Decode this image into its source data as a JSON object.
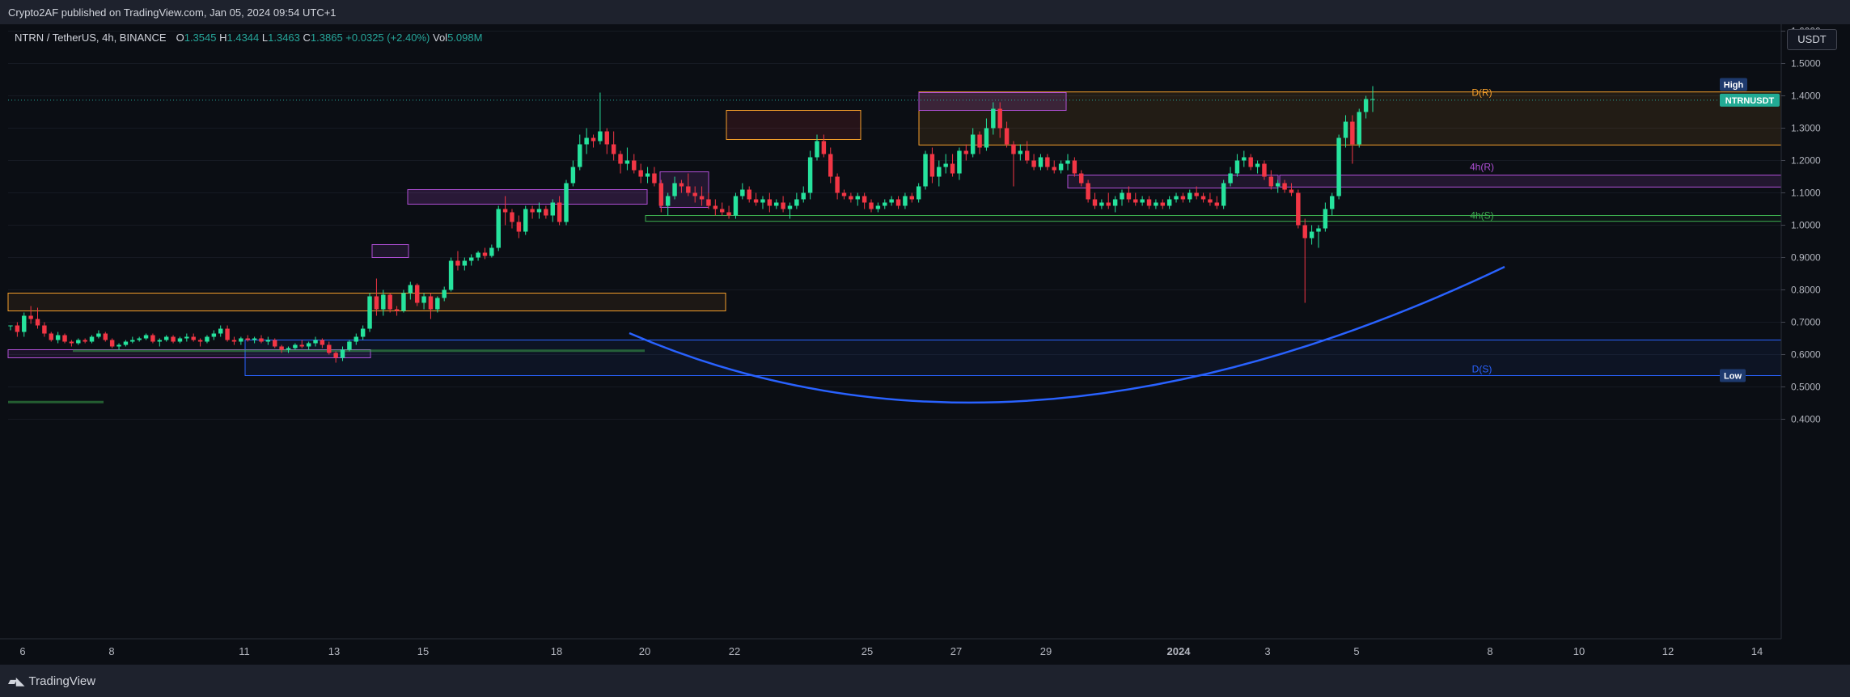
{
  "header": {
    "published": "Crypto2AF published on TradingView.com, Jan 05, 2024 09:54 UTC+1"
  },
  "legend": {
    "symbol": "NTRN / TetherUS, 4h, BINANCE",
    "o_label": "O",
    "o_value": "1.3545",
    "h_label": "H",
    "h_value": "1.4344",
    "l_label": "L",
    "l_value": "1.3463",
    "c_label": "C",
    "c_value": "1.3865",
    "change": "+0.0325 (+2.40%)",
    "vol_label": "Vol",
    "vol_value": "5.098M"
  },
  "price_scale": {
    "unit": "USDT",
    "high_tag": "High",
    "low_tag": "Low",
    "symbol_tag": "NTRNUSDT"
  },
  "footer": {
    "brand": "TradingView"
  },
  "colors": {
    "up": "#26e39d",
    "down": "#f23645",
    "curve": "#2962ff",
    "daily_res": "#f59f2b",
    "res4h": "#b04fd6",
    "sup4h": "#3dae4f",
    "daily_sup": "#2962ff"
  },
  "chart_data": {
    "type": "candlestick",
    "symbol": "NTRN / TetherUS",
    "interval": "4h",
    "exchange": "BINANCE",
    "ylim": [
      0.38,
      1.9
    ],
    "y_ticks": [
      "1.6000",
      "1.5000",
      "1.4000",
      "1.3000",
      "1.2000",
      "1.1000",
      "1.0000",
      "0.9000",
      "0.8000",
      "0.7000",
      "0.6000",
      "0.5000",
      "0.4000"
    ],
    "x_ticks": [
      "6",
      "8",
      "11",
      "13",
      "15",
      "18",
      "20",
      "22",
      "25",
      "27",
      "29",
      "2024",
      "3",
      "5",
      "8",
      "10",
      "12",
      "14"
    ],
    "last_price": 1.3865,
    "zones": [
      {
        "label": "D(R)",
        "from": 1.248,
        "to": 1.412
      },
      {
        "label": "4h(R)",
        "from": 1.118,
        "to": 1.155
      },
      {
        "label": "4h(S)",
        "from": 1.012,
        "to": 1.03
      },
      {
        "label": "D(S)",
        "from": 0.535,
        "to": 0.645
      }
    ],
    "annotations": [
      "D(R)",
      "4h(R)",
      "4h(S)",
      "D(S)"
    ],
    "candles": [
      [
        0.69,
        0.69,
        0.675,
        0.69
      ],
      [
        0.69,
        0.7,
        0.655,
        0.67
      ],
      [
        0.67,
        0.73,
        0.655,
        0.72
      ],
      [
        0.72,
        0.75,
        0.695,
        0.71
      ],
      [
        0.71,
        0.745,
        0.68,
        0.69
      ],
      [
        0.69,
        0.7,
        0.655,
        0.665
      ],
      [
        0.665,
        0.67,
        0.64,
        0.645
      ],
      [
        0.645,
        0.67,
        0.635,
        0.66
      ],
      [
        0.66,
        0.665,
        0.635,
        0.64
      ],
      [
        0.64,
        0.645,
        0.625,
        0.635
      ],
      [
        0.635,
        0.65,
        0.63,
        0.645
      ],
      [
        0.645,
        0.65,
        0.635,
        0.64
      ],
      [
        0.64,
        0.66,
        0.635,
        0.655
      ],
      [
        0.655,
        0.675,
        0.65,
        0.665
      ],
      [
        0.665,
        0.67,
        0.64,
        0.645
      ],
      [
        0.645,
        0.65,
        0.62,
        0.625
      ],
      [
        0.625,
        0.635,
        0.615,
        0.63
      ],
      [
        0.63,
        0.645,
        0.625,
        0.64
      ],
      [
        0.64,
        0.655,
        0.635,
        0.645
      ],
      [
        0.645,
        0.655,
        0.64,
        0.65
      ],
      [
        0.65,
        0.665,
        0.645,
        0.66
      ],
      [
        0.66,
        0.665,
        0.635,
        0.64
      ],
      [
        0.64,
        0.65,
        0.625,
        0.645
      ],
      [
        0.645,
        0.66,
        0.64,
        0.655
      ],
      [
        0.655,
        0.66,
        0.635,
        0.64
      ],
      [
        0.64,
        0.655,
        0.635,
        0.65
      ],
      [
        0.65,
        0.665,
        0.64,
        0.655
      ],
      [
        0.655,
        0.665,
        0.64,
        0.645
      ],
      [
        0.645,
        0.65,
        0.625,
        0.64
      ],
      [
        0.64,
        0.66,
        0.635,
        0.655
      ],
      [
        0.655,
        0.675,
        0.645,
        0.665
      ],
      [
        0.665,
        0.69,
        0.655,
        0.68
      ],
      [
        0.68,
        0.69,
        0.64,
        0.645
      ],
      [
        0.645,
        0.655,
        0.63,
        0.64
      ],
      [
        0.64,
        0.655,
        0.63,
        0.65
      ],
      [
        0.65,
        0.66,
        0.64,
        0.645
      ],
      [
        0.645,
        0.655,
        0.635,
        0.65
      ],
      [
        0.65,
        0.66,
        0.635,
        0.64
      ],
      [
        0.64,
        0.655,
        0.63,
        0.645
      ],
      [
        0.645,
        0.65,
        0.62,
        0.625
      ],
      [
        0.625,
        0.63,
        0.605,
        0.615
      ],
      [
        0.615,
        0.625,
        0.605,
        0.62
      ],
      [
        0.62,
        0.635,
        0.615,
        0.63
      ],
      [
        0.63,
        0.645,
        0.62,
        0.625
      ],
      [
        0.625,
        0.64,
        0.615,
        0.635
      ],
      [
        0.635,
        0.655,
        0.625,
        0.645
      ],
      [
        0.645,
        0.65,
        0.62,
        0.63
      ],
      [
        0.63,
        0.64,
        0.6,
        0.605
      ],
      [
        0.605,
        0.61,
        0.575,
        0.59
      ],
      [
        0.59,
        0.625,
        0.58,
        0.615
      ],
      [
        0.615,
        0.645,
        0.61,
        0.64
      ],
      [
        0.64,
        0.665,
        0.63,
        0.655
      ],
      [
        0.655,
        0.69,
        0.645,
        0.68
      ],
      [
        0.68,
        0.79,
        0.67,
        0.78
      ],
      [
        0.78,
        0.835,
        0.72,
        0.74
      ],
      [
        0.74,
        0.8,
        0.72,
        0.785
      ],
      [
        0.785,
        0.79,
        0.73,
        0.74
      ],
      [
        0.74,
        0.75,
        0.72,
        0.735
      ],
      [
        0.735,
        0.8,
        0.73,
        0.79
      ],
      [
        0.79,
        0.825,
        0.77,
        0.815
      ],
      [
        0.815,
        0.82,
        0.75,
        0.76
      ],
      [
        0.76,
        0.79,
        0.74,
        0.78
      ],
      [
        0.78,
        0.79,
        0.71,
        0.74
      ],
      [
        0.74,
        0.78,
        0.73,
        0.775
      ],
      [
        0.775,
        0.81,
        0.765,
        0.8
      ],
      [
        0.8,
        0.9,
        0.795,
        0.89
      ],
      [
        0.89,
        0.92,
        0.86,
        0.875
      ],
      [
        0.875,
        0.9,
        0.86,
        0.89
      ],
      [
        0.89,
        0.91,
        0.875,
        0.9
      ],
      [
        0.9,
        0.92,
        0.89,
        0.915
      ],
      [
        0.915,
        0.93,
        0.895,
        0.905
      ],
      [
        0.905,
        0.94,
        0.9,
        0.93
      ],
      [
        0.93,
        1.06,
        0.92,
        1.05
      ],
      [
        1.05,
        1.09,
        1.0,
        1.04
      ],
      [
        1.04,
        1.05,
        0.99,
        1.01
      ],
      [
        1.01,
        1.03,
        0.96,
        0.98
      ],
      [
        0.98,
        1.06,
        0.97,
        1.05
      ],
      [
        1.05,
        1.06,
        1.02,
        1.04
      ],
      [
        1.04,
        1.07,
        1.02,
        1.05
      ],
      [
        1.05,
        1.06,
        1.02,
        1.03
      ],
      [
        1.03,
        1.08,
        1.01,
        1.07
      ],
      [
        1.07,
        1.09,
        1.0,
        1.01
      ],
      [
        1.01,
        1.14,
        1.0,
        1.13
      ],
      [
        1.13,
        1.2,
        1.12,
        1.18
      ],
      [
        1.18,
        1.28,
        1.17,
        1.25
      ],
      [
        1.25,
        1.3,
        1.22,
        1.27
      ],
      [
        1.27,
        1.28,
        1.24,
        1.26
      ],
      [
        1.26,
        1.41,
        1.25,
        1.29
      ],
      [
        1.29,
        1.3,
        1.22,
        1.25
      ],
      [
        1.25,
        1.29,
        1.2,
        1.22
      ],
      [
        1.22,
        1.23,
        1.16,
        1.19
      ],
      [
        1.19,
        1.24,
        1.17,
        1.2
      ],
      [
        1.2,
        1.22,
        1.16,
        1.17
      ],
      [
        1.17,
        1.19,
        1.13,
        1.15
      ],
      [
        1.15,
        1.18,
        1.13,
        1.16
      ],
      [
        1.16,
        1.18,
        1.12,
        1.13
      ],
      [
        1.13,
        1.14,
        1.04,
        1.06
      ],
      [
        1.06,
        1.1,
        1.03,
        1.09
      ],
      [
        1.09,
        1.15,
        1.08,
        1.13
      ],
      [
        1.13,
        1.14,
        1.1,
        1.12
      ],
      [
        1.12,
        1.16,
        1.09,
        1.1
      ],
      [
        1.1,
        1.12,
        1.07,
        1.09
      ],
      [
        1.09,
        1.12,
        1.06,
        1.08
      ],
      [
        1.08,
        1.1,
        1.05,
        1.06
      ],
      [
        1.06,
        1.08,
        1.03,
        1.05
      ],
      [
        1.05,
        1.07,
        1.03,
        1.04
      ],
      [
        1.04,
        1.06,
        1.02,
        1.03
      ],
      [
        1.03,
        1.1,
        1.02,
        1.09
      ],
      [
        1.09,
        1.13,
        1.08,
        1.11
      ],
      [
        1.11,
        1.12,
        1.07,
        1.08
      ],
      [
        1.08,
        1.1,
        1.06,
        1.07
      ],
      [
        1.07,
        1.09,
        1.05,
        1.08
      ],
      [
        1.08,
        1.1,
        1.04,
        1.06
      ],
      [
        1.06,
        1.08,
        1.05,
        1.07
      ],
      [
        1.07,
        1.09,
        1.04,
        1.05
      ],
      [
        1.05,
        1.07,
        1.02,
        1.06
      ],
      [
        1.06,
        1.1,
        1.05,
        1.08
      ],
      [
        1.08,
        1.12,
        1.07,
        1.1
      ],
      [
        1.1,
        1.23,
        1.08,
        1.21
      ],
      [
        1.21,
        1.28,
        1.2,
        1.26
      ],
      [
        1.26,
        1.28,
        1.21,
        1.22
      ],
      [
        1.22,
        1.24,
        1.13,
        1.15
      ],
      [
        1.15,
        1.16,
        1.08,
        1.1
      ],
      [
        1.1,
        1.11,
        1.08,
        1.09
      ],
      [
        1.09,
        1.1,
        1.07,
        1.08
      ],
      [
        1.08,
        1.1,
        1.06,
        1.09
      ],
      [
        1.09,
        1.1,
        1.05,
        1.07
      ],
      [
        1.07,
        1.08,
        1.04,
        1.05
      ],
      [
        1.05,
        1.07,
        1.04,
        1.06
      ],
      [
        1.06,
        1.08,
        1.05,
        1.07
      ],
      [
        1.07,
        1.09,
        1.06,
        1.08
      ],
      [
        1.08,
        1.09,
        1.05,
        1.06
      ],
      [
        1.06,
        1.1,
        1.05,
        1.09
      ],
      [
        1.09,
        1.1,
        1.07,
        1.08
      ],
      [
        1.08,
        1.13,
        1.07,
        1.12
      ],
      [
        1.12,
        1.23,
        1.11,
        1.22
      ],
      [
        1.22,
        1.24,
        1.13,
        1.15
      ],
      [
        1.15,
        1.2,
        1.12,
        1.18
      ],
      [
        1.18,
        1.22,
        1.16,
        1.19
      ],
      [
        1.19,
        1.22,
        1.15,
        1.16
      ],
      [
        1.16,
        1.24,
        1.14,
        1.23
      ],
      [
        1.23,
        1.25,
        1.2,
        1.22
      ],
      [
        1.22,
        1.3,
        1.21,
        1.28
      ],
      [
        1.28,
        1.29,
        1.22,
        1.24
      ],
      [
        1.24,
        1.33,
        1.23,
        1.3
      ],
      [
        1.3,
        1.38,
        1.28,
        1.36
      ],
      [
        1.36,
        1.38,
        1.27,
        1.3
      ],
      [
        1.3,
        1.32,
        1.24,
        1.25
      ],
      [
        1.25,
        1.26,
        1.12,
        1.22
      ],
      [
        1.22,
        1.25,
        1.2,
        1.23
      ],
      [
        1.23,
        1.26,
        1.19,
        1.2
      ],
      [
        1.2,
        1.22,
        1.17,
        1.18
      ],
      [
        1.18,
        1.22,
        1.17,
        1.21
      ],
      [
        1.21,
        1.22,
        1.17,
        1.18
      ],
      [
        1.18,
        1.2,
        1.16,
        1.17
      ],
      [
        1.17,
        1.2,
        1.16,
        1.19
      ],
      [
        1.19,
        1.22,
        1.17,
        1.2
      ],
      [
        1.2,
        1.21,
        1.15,
        1.16
      ],
      [
        1.16,
        1.17,
        1.12,
        1.13
      ],
      [
        1.13,
        1.14,
        1.07,
        1.08
      ],
      [
        1.08,
        1.1,
        1.05,
        1.06
      ],
      [
        1.06,
        1.08,
        1.05,
        1.07
      ],
      [
        1.07,
        1.1,
        1.05,
        1.06
      ],
      [
        1.06,
        1.09,
        1.04,
        1.08
      ],
      [
        1.08,
        1.11,
        1.06,
        1.1
      ],
      [
        1.1,
        1.12,
        1.07,
        1.08
      ],
      [
        1.08,
        1.1,
        1.06,
        1.07
      ],
      [
        1.07,
        1.09,
        1.06,
        1.08
      ],
      [
        1.08,
        1.09,
        1.05,
        1.06
      ],
      [
        1.06,
        1.08,
        1.05,
        1.07
      ],
      [
        1.07,
        1.08,
        1.05,
        1.06
      ],
      [
        1.06,
        1.09,
        1.05,
        1.08
      ],
      [
        1.08,
        1.1,
        1.07,
        1.09
      ],
      [
        1.09,
        1.1,
        1.07,
        1.08
      ],
      [
        1.08,
        1.11,
        1.07,
        1.1
      ],
      [
        1.1,
        1.12,
        1.08,
        1.09
      ],
      [
        1.09,
        1.1,
        1.07,
        1.08
      ],
      [
        1.08,
        1.1,
        1.06,
        1.07
      ],
      [
        1.07,
        1.09,
        1.05,
        1.06
      ],
      [
        1.06,
        1.14,
        1.05,
        1.13
      ],
      [
        1.13,
        1.18,
        1.12,
        1.16
      ],
      [
        1.16,
        1.22,
        1.15,
        1.2
      ],
      [
        1.2,
        1.23,
        1.18,
        1.21
      ],
      [
        1.21,
        1.22,
        1.17,
        1.18
      ],
      [
        1.18,
        1.2,
        1.16,
        1.19
      ],
      [
        1.19,
        1.2,
        1.14,
        1.15
      ],
      [
        1.15,
        1.17,
        1.11,
        1.12
      ],
      [
        1.12,
        1.14,
        1.1,
        1.13
      ],
      [
        1.13,
        1.14,
        1.1,
        1.11
      ],
      [
        1.11,
        1.13,
        1.09,
        1.1
      ],
      [
        1.1,
        1.11,
        0.99,
        1.0
      ],
      [
        1.0,
        1.02,
        0.76,
        0.96
      ],
      [
        0.96,
        1.0,
        0.94,
        0.98
      ],
      [
        0.98,
        1.0,
        0.93,
        0.99
      ],
      [
        0.99,
        1.07,
        0.98,
        1.05
      ],
      [
        1.05,
        1.1,
        1.03,
        1.09
      ],
      [
        1.09,
        1.28,
        1.08,
        1.27
      ],
      [
        1.27,
        1.34,
        1.24,
        1.32
      ],
      [
        1.32,
        1.34,
        1.19,
        1.25
      ],
      [
        1.25,
        1.36,
        1.24,
        1.35
      ],
      [
        1.35,
        1.4,
        1.33,
        1.39
      ],
      [
        1.39,
        1.43,
        1.35,
        1.39
      ]
    ]
  }
}
